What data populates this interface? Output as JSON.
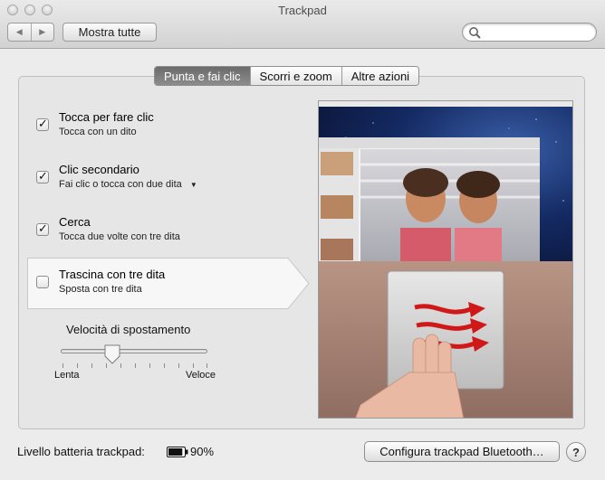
{
  "window": {
    "title": "Trackpad"
  },
  "toolbar": {
    "back_icon": "◀",
    "forward_icon": "▶",
    "show_all_label": "Mostra tutte",
    "search_value": "",
    "search_icon": "magnifier-icon"
  },
  "tabs": [
    {
      "label": "Punta e fai clic",
      "active": true
    },
    {
      "label": "Scorri e zoom",
      "active": false
    },
    {
      "label": "Altre azioni",
      "active": false
    }
  ],
  "options": [
    {
      "title": "Tocca per fare clic",
      "subtitle": "Tocca con un dito",
      "checked": true
    },
    {
      "title": "Clic secondario",
      "subtitle": "Fai clic o tocca con due dita",
      "checked": true,
      "has_menu": true,
      "menu_icon": "▼"
    },
    {
      "title": "Cerca",
      "subtitle": "Tocca due volte con tre dita",
      "checked": true
    },
    {
      "title": "Trascina con tre dita",
      "subtitle": "Sposta con tre dita",
      "checked": false,
      "selected": true
    }
  ],
  "tracking_speed": {
    "label": "Velocità di spostamento",
    "min_label": "Lenta",
    "max_label": "Veloce",
    "value": 0.35
  },
  "footer": {
    "battery_label": "Livello batteria trackpad:",
    "battery_value": "90%",
    "battery_level": 0.9,
    "configure_button": "Configura trackpad Bluetooth…",
    "help_label": "?"
  },
  "colors": {
    "window_bg": "#ececec",
    "selected_tab": "#7a7a7a",
    "arrow_red": "#d01818",
    "night_sky": "#0e1f4a",
    "desk": "#a9877a"
  }
}
